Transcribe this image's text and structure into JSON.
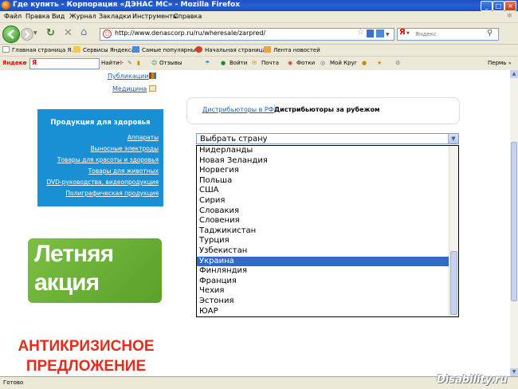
{
  "window": {
    "title": "Где купить - Корпорация «ДЭНАС МС» - Mozilla Firefox",
    "colors": {
      "titlebar": "#2457cc",
      "chrome": "#ece9d8",
      "link": "#1a5fb4",
      "health_box": "#1b8fd4",
      "promo_green": "#6bb036",
      "red_text": "#e32d1b",
      "selected": "#316ac5"
    }
  },
  "menu": [
    "Файл",
    "Правка",
    "Вид",
    "Журнал",
    "Закладки",
    "Инструменты",
    "Справка"
  ],
  "navbar": {
    "url": "http://www.denascorp.ru/ru/wheresale/zarpred/",
    "search_engine_label": "Я",
    "search_placeholder": "Яндекс"
  },
  "bookmarks": [
    "Главная страница Я...",
    "Сервисы Яндекса",
    "Самые популярные",
    "Начальная страница",
    "Лента новостей"
  ],
  "yandex_bar": {
    "logo": "Яндекс",
    "search_prefix": "Я",
    "find": "Найти",
    "reviews": "Отзывы",
    "login": "Войти",
    "mail": "Почта",
    "photos": "Фотки",
    "my_circle": "Мой Круг",
    "region": "Пермь"
  },
  "sidebar": {
    "top_links": [
      "Публикации",
      "Медицина"
    ],
    "health": {
      "heading": "Продукция для здоровья",
      "items": [
        "Аппараты",
        "Выносные электроды",
        "Товары для красоты и здоровья",
        "Товары для животных",
        "DVD-руководства, видеопродукция",
        "Полиграфическая продукция"
      ]
    },
    "promo": {
      "line1": "Летняя",
      "line2": "акция"
    },
    "anticrisis": {
      "line1": "АНТИКРИЗИСНОЕ",
      "line2": "ПРЕДЛОЖЕНИЕ"
    }
  },
  "main": {
    "tab_link": "Дистрибьюторы в РФ",
    "tab_active": "Дистрибьюторы за рубежом",
    "country_select": {
      "value": "Выбрать страну",
      "options": [
        "Нидерланды",
        "Новая Зеландия",
        "Норвегия",
        "Польша",
        "США",
        "Сирия",
        "Словакия",
        "Словения",
        "Таджикистан",
        "Турция",
        "Узбекистан",
        "Украина",
        "Финляндия",
        "Франция",
        "Чехия",
        "Эстония",
        "ЮАР"
      ],
      "highlighted": "Украина"
    }
  },
  "status": {
    "text": "Готово"
  },
  "watermark": "Disability.ru"
}
